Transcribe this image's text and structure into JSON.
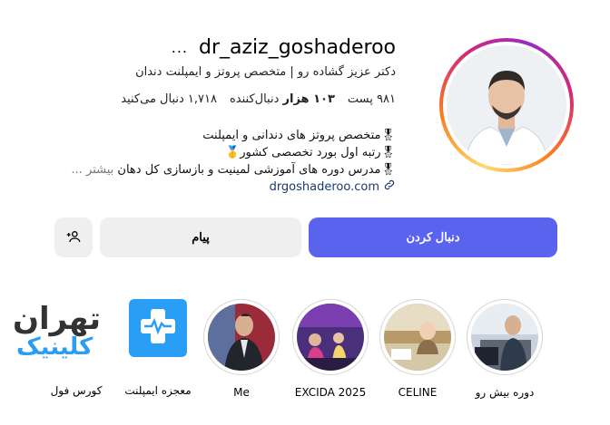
{
  "profile": {
    "username": "dr_aziz_goshaderoo",
    "more_label": "...",
    "title_line": "دکتر عزیز گشاده رو | متخصص پروتز و ایمپلنت دندان",
    "stats": {
      "posts": "۹۸۱ پست",
      "followers_num": "۱۰۳ هزار",
      "followers_label": "دنبال‌کننده",
      "following": "۱,۷۱۸ دنبال می‌کنید"
    },
    "bio": {
      "line1": "🎖متخصص پروتز های دندانی و ایمپلنت",
      "line2": "🎖رتبه اول بورد تخصصی کشور🥇",
      "line3": "🎖مدرس دوره های آموزشی لمینیت و بازسازی کل دهان",
      "more": "بیشتر ..."
    },
    "link": "drgoshaderoo.com"
  },
  "actions": {
    "follow": "دنبال کردن",
    "message": "پیام"
  },
  "highlights": [
    {
      "label": "دوره بیش رو"
    },
    {
      "label": "CELINE"
    },
    {
      "label": "EXCIDA 2025"
    },
    {
      "label": "Me"
    },
    {
      "label": "معجزه ایمپلنت"
    },
    {
      "label": "کورس فول"
    }
  ],
  "clinic_logo": {
    "line1": "تهران",
    "line2": "کلینیک"
  },
  "colors": {
    "follow_button": "#5a63ee",
    "secondary_button": "#efefef",
    "link": "#1a3a73",
    "logo_blue": "#2a9df4"
  }
}
